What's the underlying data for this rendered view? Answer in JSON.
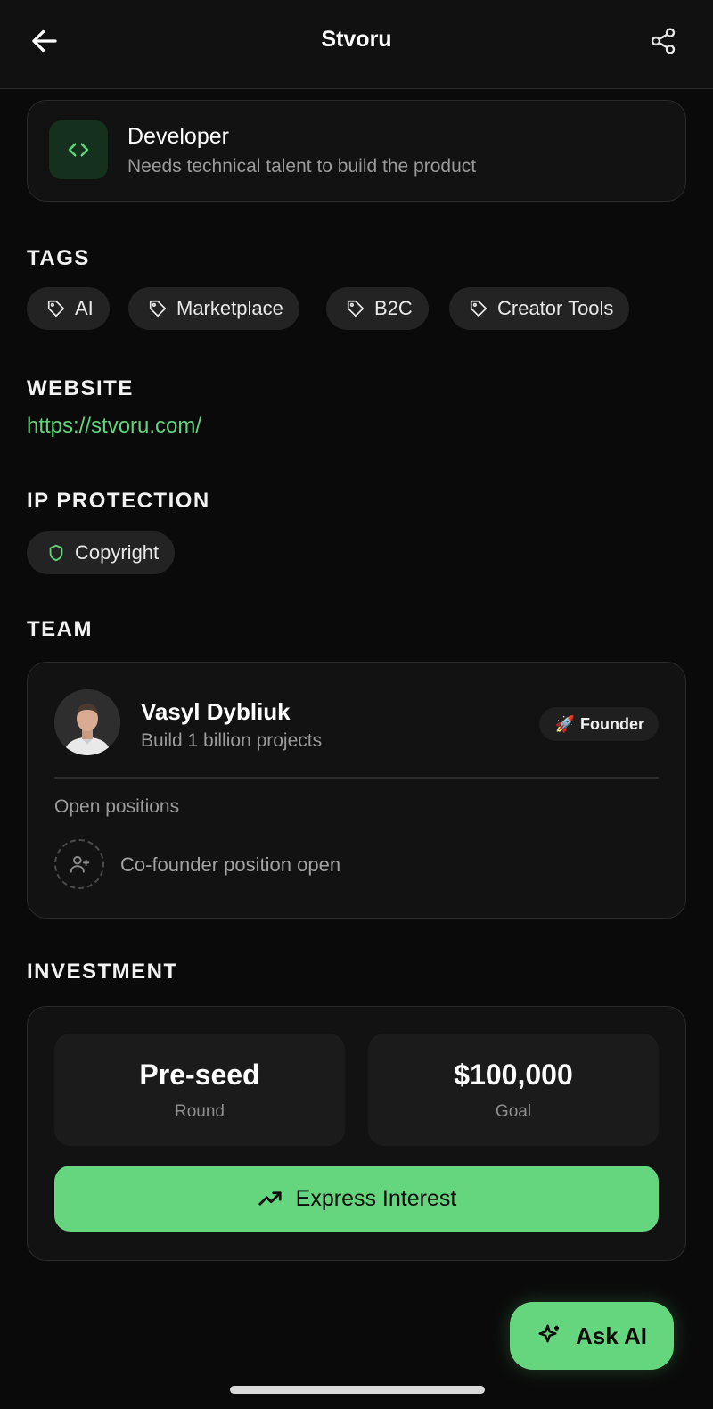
{
  "header": {
    "title": "Stvoru",
    "back_icon": "arrow-left-icon",
    "share_icon": "share-icon"
  },
  "role": {
    "title": "Developer",
    "description": "Needs technical talent to build the product",
    "icon": "code-icon"
  },
  "tags": {
    "label": "TAGS",
    "items": [
      "AI",
      "Marketplace",
      "B2C",
      "Creator Tools"
    ]
  },
  "website": {
    "label": "WEBSITE",
    "url": "https://stvoru.com/"
  },
  "ip": {
    "label": "IP PROTECTION",
    "value": "Copyright"
  },
  "team": {
    "label": "TEAM",
    "member": {
      "name": "Vasyl Dybliuk",
      "bio": "Build 1 billion projects",
      "badge": "Founder",
      "badge_emoji": "🚀"
    },
    "open_label": "Open positions",
    "open_position": "Co-founder position open"
  },
  "investment": {
    "label": "INVESTMENT",
    "round_value": "Pre-seed",
    "round_label": "Round",
    "goal_value": "$100,000",
    "goal_label": "Goal",
    "cta": "Express Interest"
  },
  "fab": {
    "label": "Ask AI"
  },
  "colors": {
    "accent": "#65d67d",
    "background": "#0a0a0a",
    "card": "#121212",
    "link": "#5fd47a"
  }
}
